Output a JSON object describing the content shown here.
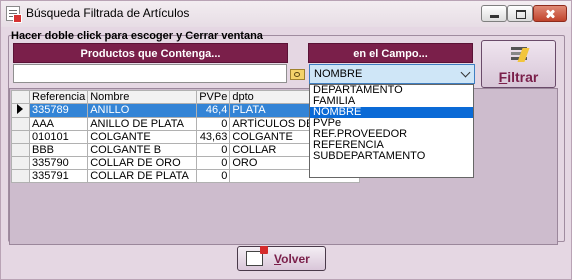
{
  "window": {
    "title": "Búsqueda Filtrada de Artículos",
    "close_color": "#c0432c"
  },
  "hint": "Hacer doble click para escoger y Cerrar ventana",
  "filters": {
    "products_header": "Productos que Contenga...",
    "field_header": "en el Campo...",
    "search_value": "",
    "selected_field": "NOMBRE",
    "field_options": [
      "DEPARTAMENTO",
      "FAMILIA",
      "NOMBRE",
      "PVPe",
      "REF.PROVEEDOR",
      "REFERENCIA",
      "SUBDEPARTAMENTO"
    ],
    "filter_button": {
      "first": "F",
      "rest": "iltrar"
    }
  },
  "grid": {
    "columns": [
      "Referencia",
      "Nombre",
      "PVPe",
      "dpto"
    ],
    "rows": [
      {
        "ref": "335789",
        "nombre": "ANILLO",
        "pvpe": "46,4",
        "dpto": "PLATA",
        "selected": true
      },
      {
        "ref": "AAA",
        "nombre": "ANILLO DE PLATA",
        "pvpe": "0",
        "dpto": "ARTÍCULOS DE"
      },
      {
        "ref": "010101",
        "nombre": "COLGANTE",
        "pvpe": "43,63",
        "dpto": "COLGANTE"
      },
      {
        "ref": "BBB",
        "nombre": "COLGANTE B",
        "pvpe": "0",
        "dpto": "COLLAR"
      },
      {
        "ref": "335790",
        "nombre": "COLLAR DE ORO",
        "pvpe": "0",
        "dpto": "ORO"
      },
      {
        "ref": "335791",
        "nombre": "COLLAR DE PLATA",
        "pvpe": "0",
        "dpto": ""
      }
    ]
  },
  "footer": {
    "back_button": {
      "first": "V",
      "rest": "olver"
    }
  },
  "colors": {
    "header_bg": "#7a1f4a",
    "selection": "#3384d6",
    "accent_text": "#7a1f4a"
  },
  "icons": [
    "app-icon",
    "minimize-icon",
    "maximize-icon",
    "close-icon",
    "folder-search-icon",
    "chevron-down-icon",
    "filter-icon",
    "row-pointer-icon",
    "back-icon"
  ]
}
